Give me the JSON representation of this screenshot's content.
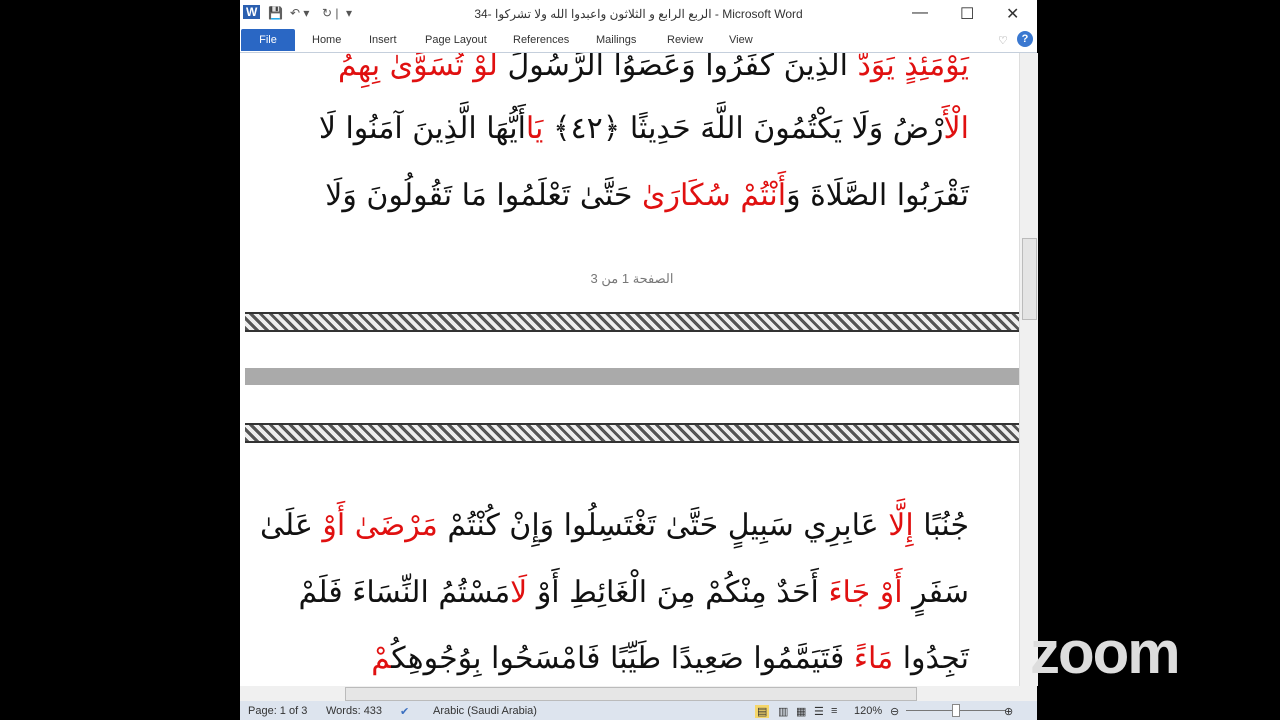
{
  "titlebar": {
    "title": "34- الربع  الرابع و الثلاثون واعبدوا الله ولا تشركوا - Microsoft Word",
    "app_icon": "W",
    "minimize": "—",
    "maximize": "☐",
    "close": "✕"
  },
  "ribbon": {
    "tabs": [
      "File",
      "Home",
      "Insert",
      "Page Layout",
      "References",
      "Mailings",
      "Review",
      "View"
    ],
    "help": "?"
  },
  "document": {
    "page1_lines": [
      [
        {
          "t": "يَوْمَئِذٍ",
          "r": 1
        },
        {
          "t": " يَوَدُّ ",
          "r": 1
        },
        {
          "t": "الَّذِينَ كَفَرُوا وَعَصَوُا الرَّسُولَ "
        },
        {
          "t": "لَوْ تُسَوَّىٰ",
          "r": 1
        },
        {
          "t": " بِهِمُ",
          "r": 1
        }
      ],
      [
        {
          "t": "الْأَ",
          "r": 1
        },
        {
          "t": "رْضُ وَلَا يَكْتُمُونَ اللَّهَ حَدِيثًا ﴿٤٢﴾ "
        },
        {
          "t": "يَا",
          "r": 1
        },
        {
          "t": "أَيُّهَا الَّذِينَ آمَنُوا لَا"
        }
      ],
      [
        {
          "t": "تَقْرَبُوا الصَّلَاةَ وَ"
        },
        {
          "t": "أَنْتُمْ",
          "r": 1
        },
        {
          "t": " سُكَارَىٰ",
          "r": 1
        },
        {
          "t": " حَتَّىٰ تَعْلَمُوا مَا تَقُولُونَ وَلَا"
        }
      ]
    ],
    "page_footer": "الصفحة 1 من 3",
    "page2_lines": [
      [
        {
          "t": "جُنُبًا "
        },
        {
          "t": "إِلَّا",
          "r": 1
        },
        {
          "t": " عَابِرِي سَبِيلٍ حَتَّىٰ تَغْتَسِلُوا وَإِنْ كُنْتُمْ "
        },
        {
          "t": "مَرْضَىٰ",
          "r": 1
        },
        {
          "t": " أَوْ",
          "r": 1
        },
        {
          "t": " عَلَىٰ"
        }
      ],
      [
        {
          "t": "سَفَرٍ "
        },
        {
          "t": "أَوْ جَاءَ",
          "r": 1
        },
        {
          "t": " أَحَدٌ مِنْكُمْ مِنَ الْغَائِطِ أَوْ "
        },
        {
          "t": "لَ",
          "r": 1
        },
        {
          "t": "امَسْتُمُ النِّسَاءَ فَلَمْ"
        }
      ],
      [
        {
          "t": "تَجِدُوا "
        },
        {
          "t": "مَاءً",
          "r": 1
        },
        {
          "t": " فَتَيَمَّمُوا صَعِيدًا طَيِّبًا فَامْسَحُوا بِوُجُوهِكُ"
        },
        {
          "t": "مْ",
          "r": 1
        }
      ]
    ]
  },
  "status": {
    "page": "Page: 1 of 3",
    "words": "Words: 433",
    "language": "Arabic (Saudi Arabia)",
    "zoom": "120%",
    "zoom_level_percent": 120
  },
  "overlay": {
    "logo": "zoom"
  }
}
